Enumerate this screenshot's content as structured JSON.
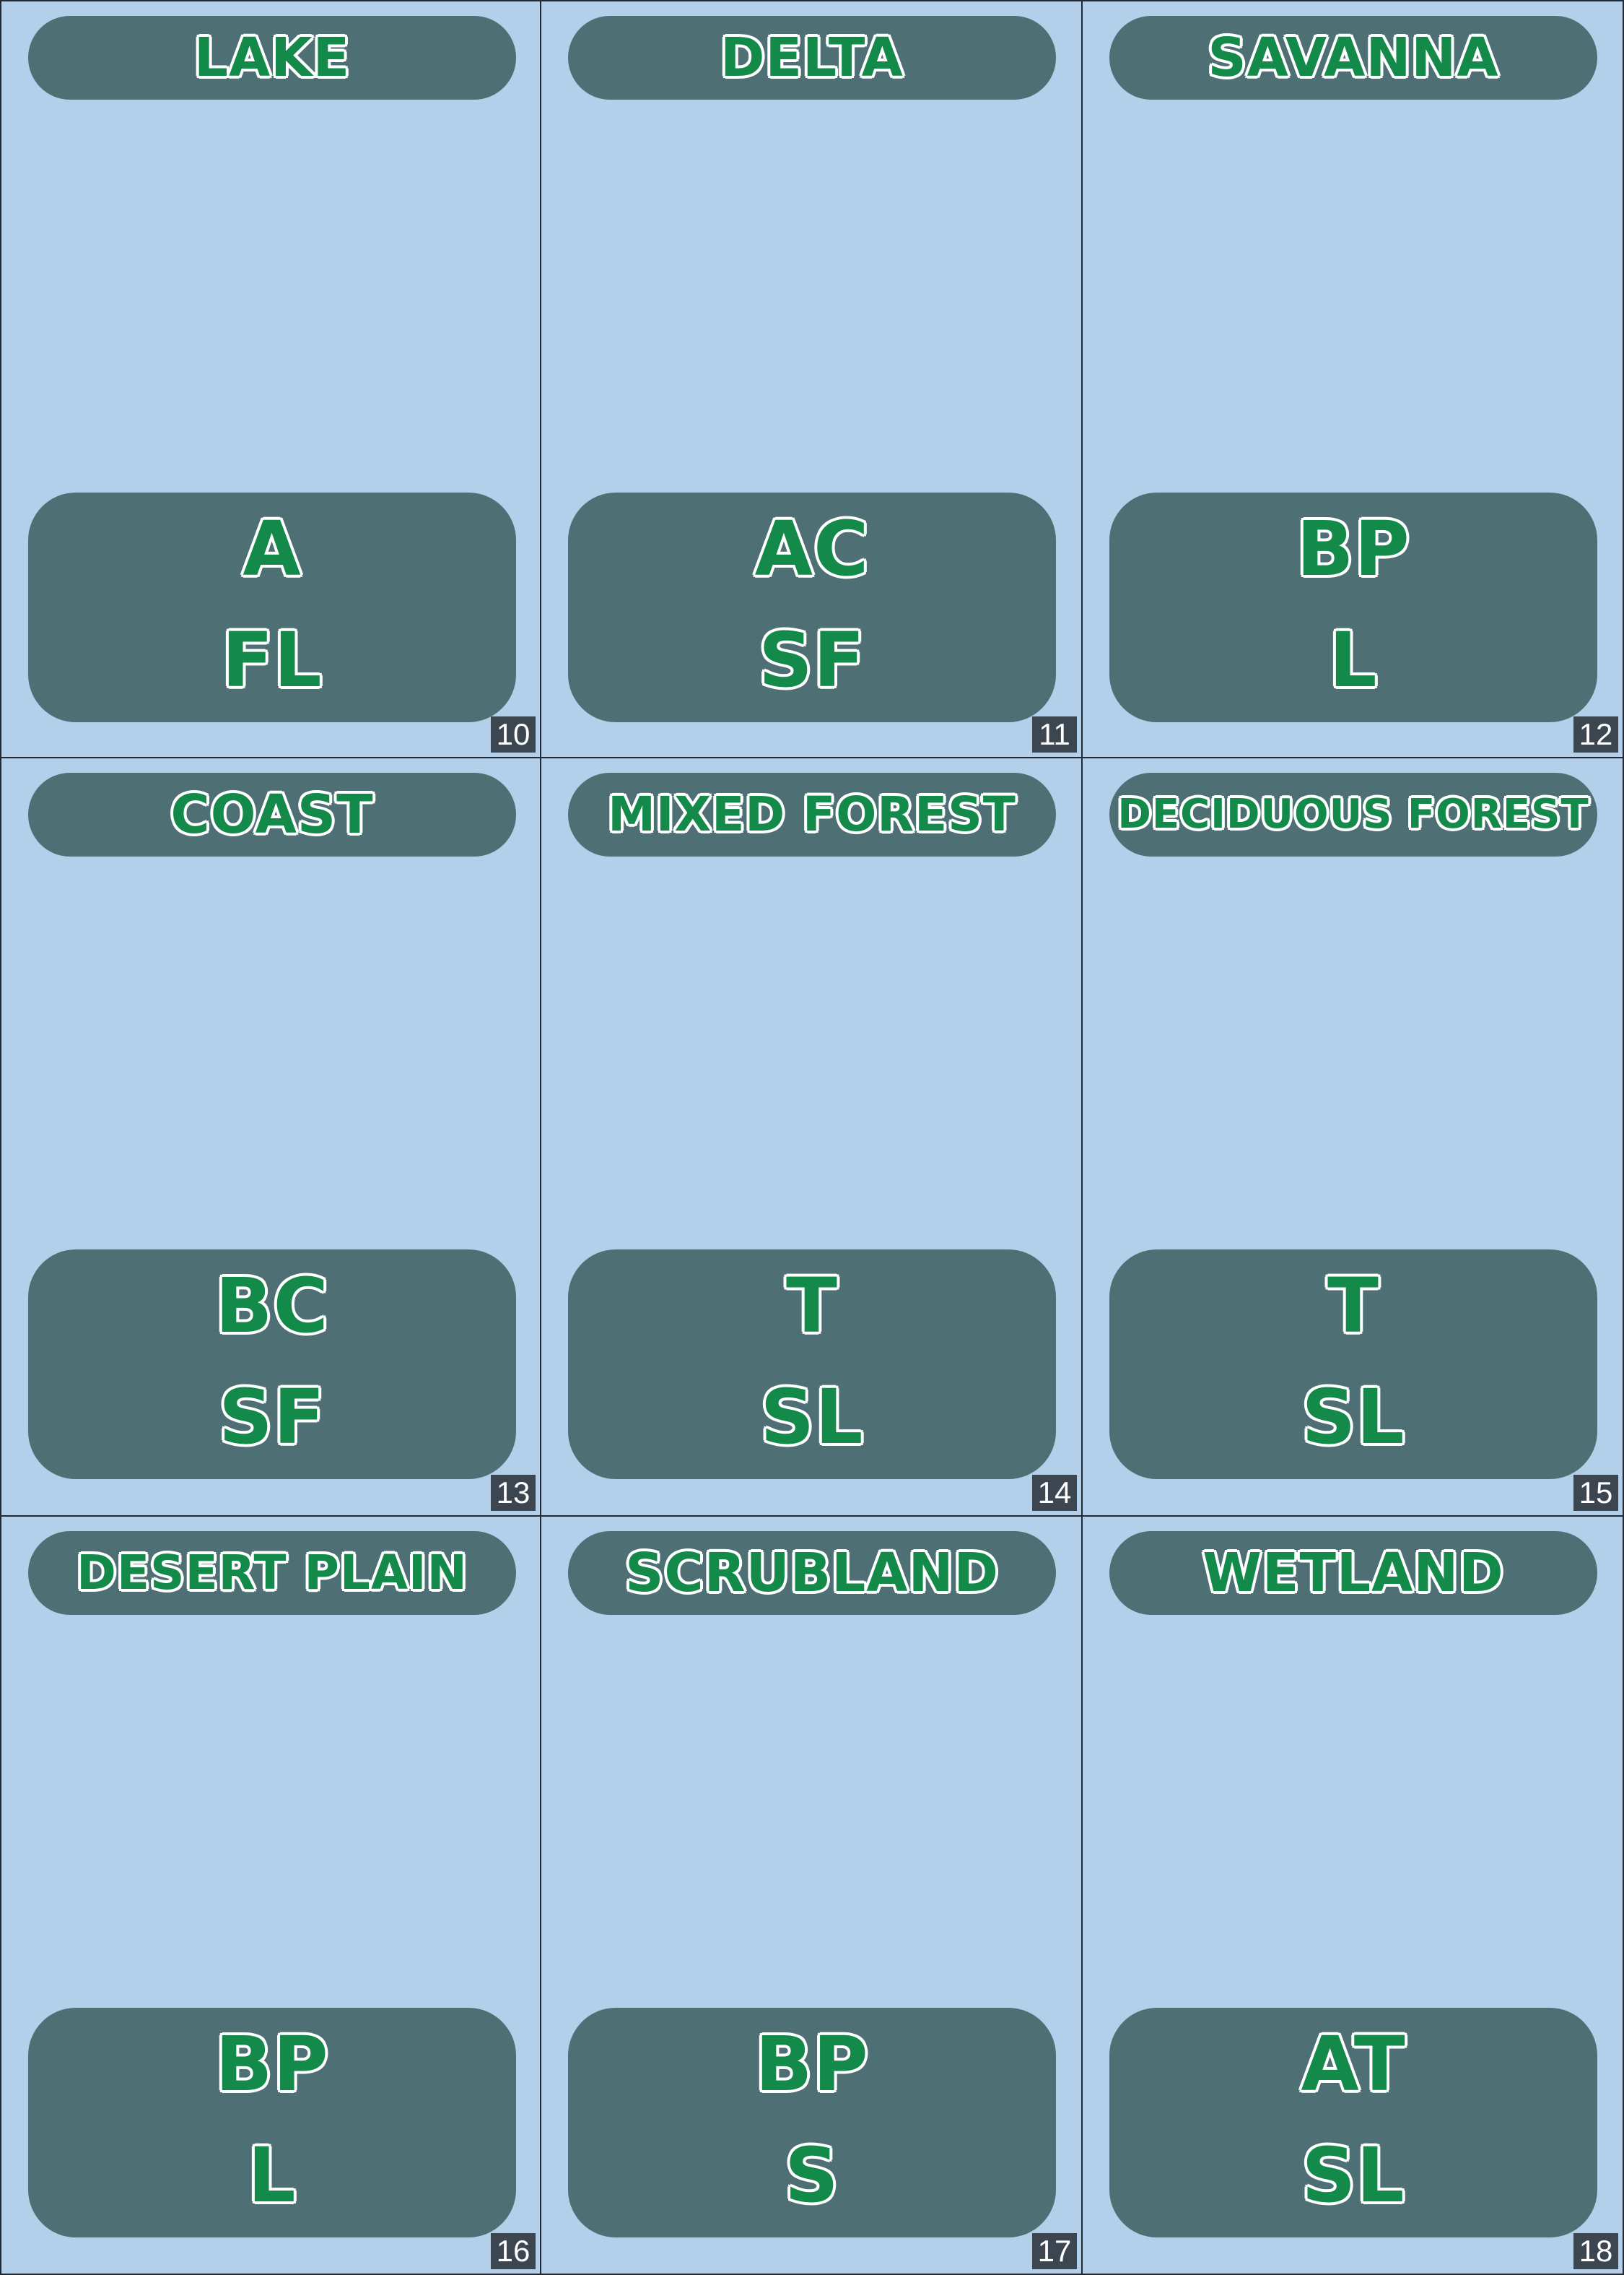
{
  "colors": {
    "card_background": "#b4cfea",
    "panel": "#4e7074",
    "lettering": "#138a4a",
    "lettering_outline": "#ffffff",
    "number_badge": "#3c4650"
  },
  "cards": [
    {
      "title": "LAKE",
      "code_top": "A",
      "code_bottom": "FL",
      "number": "10"
    },
    {
      "title": "DELTA",
      "code_top": "AC",
      "code_bottom": "SF",
      "number": "11"
    },
    {
      "title": "SAVANNA",
      "code_top": "BP",
      "code_bottom": "L",
      "number": "12"
    },
    {
      "title": "COAST",
      "code_top": "BC",
      "code_bottom": "SF",
      "number": "13"
    },
    {
      "title": "MIXED FOREST",
      "code_top": "T",
      "code_bottom": "SL",
      "number": "14"
    },
    {
      "title": "DECIDUOUS FOREST",
      "code_top": "T",
      "code_bottom": "SL",
      "number": "15"
    },
    {
      "title": "DESERT PLAIN",
      "code_top": "BP",
      "code_bottom": "L",
      "number": "16"
    },
    {
      "title": "SCRUBLAND",
      "code_top": "BP",
      "code_bottom": "S",
      "number": "17"
    },
    {
      "title": "WETLAND",
      "code_top": "AT",
      "code_bottom": "SL",
      "number": "18"
    }
  ]
}
